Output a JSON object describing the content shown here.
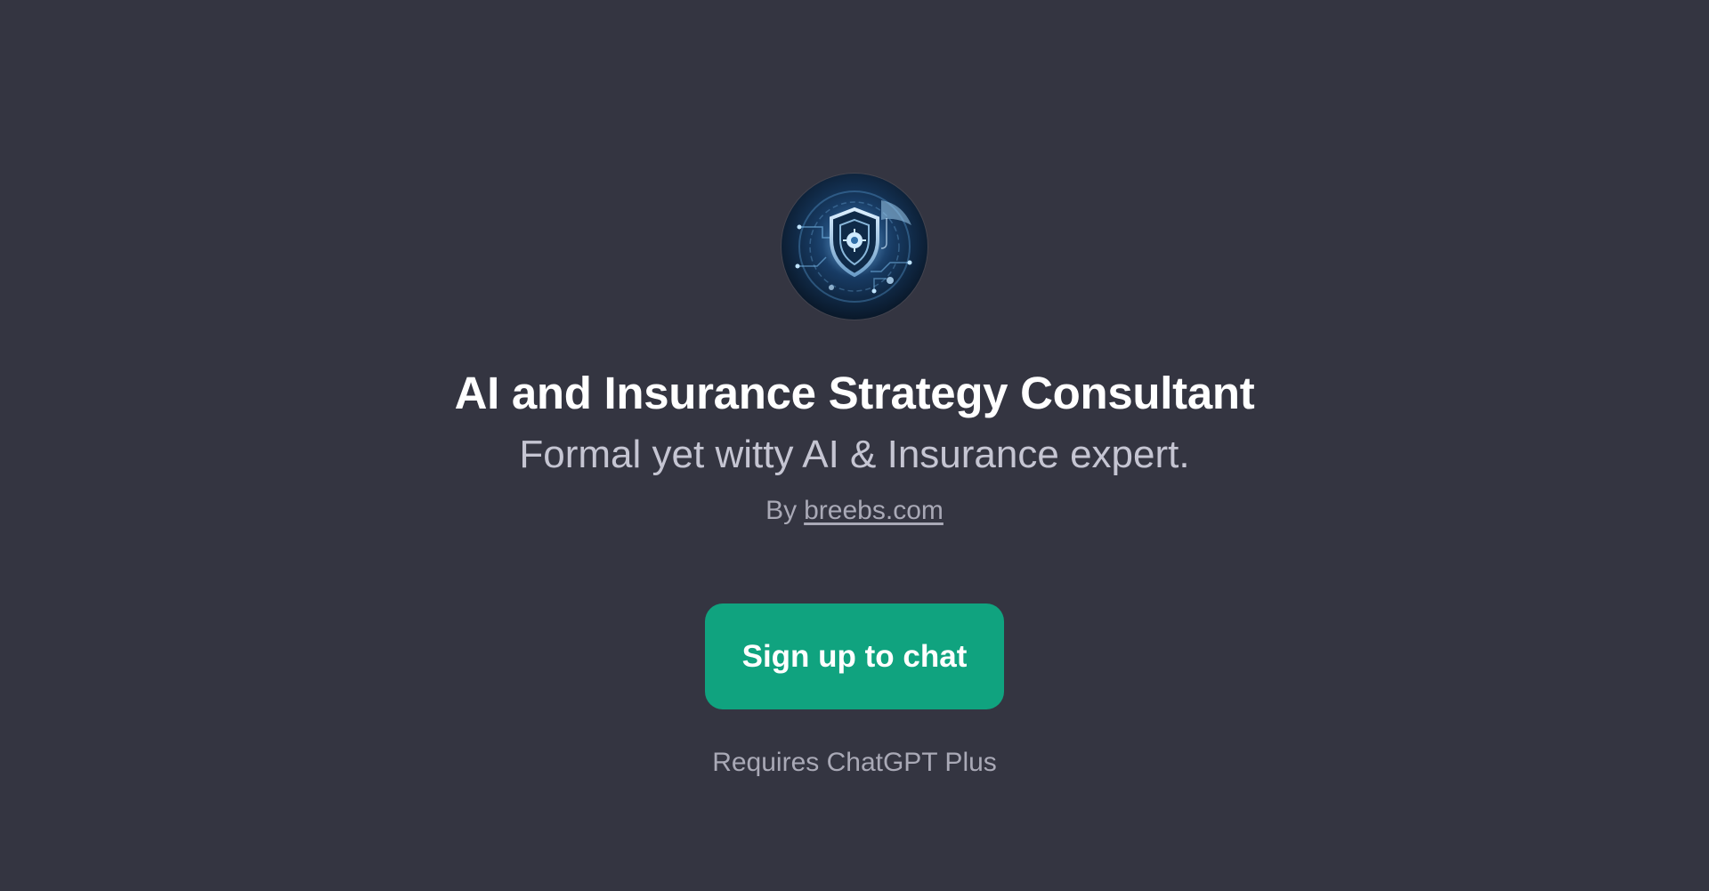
{
  "gpt": {
    "logo_icon": "shield-circuit-logo-icon",
    "title": "AI and Insurance Strategy Consultant",
    "description": "Formal yet witty AI & Insurance expert.",
    "author_prefix": "By",
    "author_link": "breebs.com"
  },
  "cta": {
    "signup_label": "Sign up to chat",
    "requirement_note": "Requires ChatGPT Plus"
  },
  "colors": {
    "background": "#343541",
    "accent": "#10a37f",
    "title_text": "#ffffff",
    "muted_text": "#a9a9b6"
  }
}
